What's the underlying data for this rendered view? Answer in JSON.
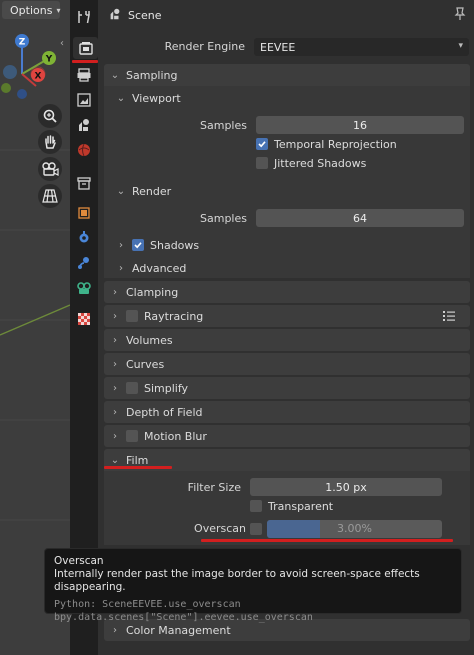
{
  "viewport": {
    "options_label": "Options",
    "gizmo_axes": {
      "z": "Z",
      "y": "Y",
      "x": "X"
    }
  },
  "tabs": [
    {
      "name": "tool-tab",
      "icon": "tool-icon"
    },
    {
      "name": "render-tab",
      "icon": "render-properties-icon",
      "active": true
    },
    {
      "name": "output-tab",
      "icon": "output-properties-icon"
    },
    {
      "name": "view-layer-tab",
      "icon": "view-layer-icon"
    },
    {
      "name": "scene-tab",
      "icon": "scene-properties-icon"
    },
    {
      "name": "world-tab",
      "icon": "world-icon"
    },
    {
      "name": "collection-tab",
      "icon": "collection-icon"
    },
    {
      "name": "object-tab",
      "icon": "object-icon"
    },
    {
      "name": "modifier-tab",
      "icon": "modifier-icon"
    },
    {
      "name": "physics-tab",
      "icon": "physics-icon"
    },
    {
      "name": "constraint-tab",
      "icon": "constraint-icon"
    },
    {
      "name": "texture-tab",
      "icon": "texture-icon"
    }
  ],
  "header": {
    "title": "Scene"
  },
  "render_engine": {
    "label": "Render Engine",
    "value": "EEVEE"
  },
  "sampling": {
    "title": "Sampling",
    "viewport": {
      "title": "Viewport",
      "samples_label": "Samples",
      "samples_value": "16",
      "temporal_reprojection": {
        "label": "Temporal Reprojection",
        "checked": true
      },
      "jittered_shadows": {
        "label": "Jittered Shadows",
        "checked": false
      }
    },
    "render": {
      "title": "Render",
      "samples_label": "Samples",
      "samples_value": "64"
    },
    "shadows": {
      "label": "Shadows",
      "checked": true
    },
    "advanced": {
      "label": "Advanced"
    }
  },
  "panels": {
    "clamping": "Clamping",
    "raytracing": "Raytracing",
    "volumes": "Volumes",
    "curves": "Curves",
    "simplify": "Simplify",
    "depth_of_field": "Depth of Field",
    "motion_blur": "Motion Blur",
    "color_management": "Color Management"
  },
  "film": {
    "title": "Film",
    "filter_size_label": "Filter Size",
    "filter_size_value": "1.50 px",
    "transparent_label": "Transparent",
    "overscan_label": "Overscan",
    "overscan_value": "3.00%",
    "overscan_fraction": 0.3
  },
  "tooltip": {
    "title": "Overscan",
    "description": "Internally render past the image border to avoid screen-space effects disappearing.",
    "python": "Python: SceneEEVEE.use_overscan",
    "path": "bpy.data.scenes[\"Scene\"].eevee.use_overscan"
  },
  "colors": {
    "accent": "#4772b3",
    "highlight_red": "#d21f1f"
  }
}
